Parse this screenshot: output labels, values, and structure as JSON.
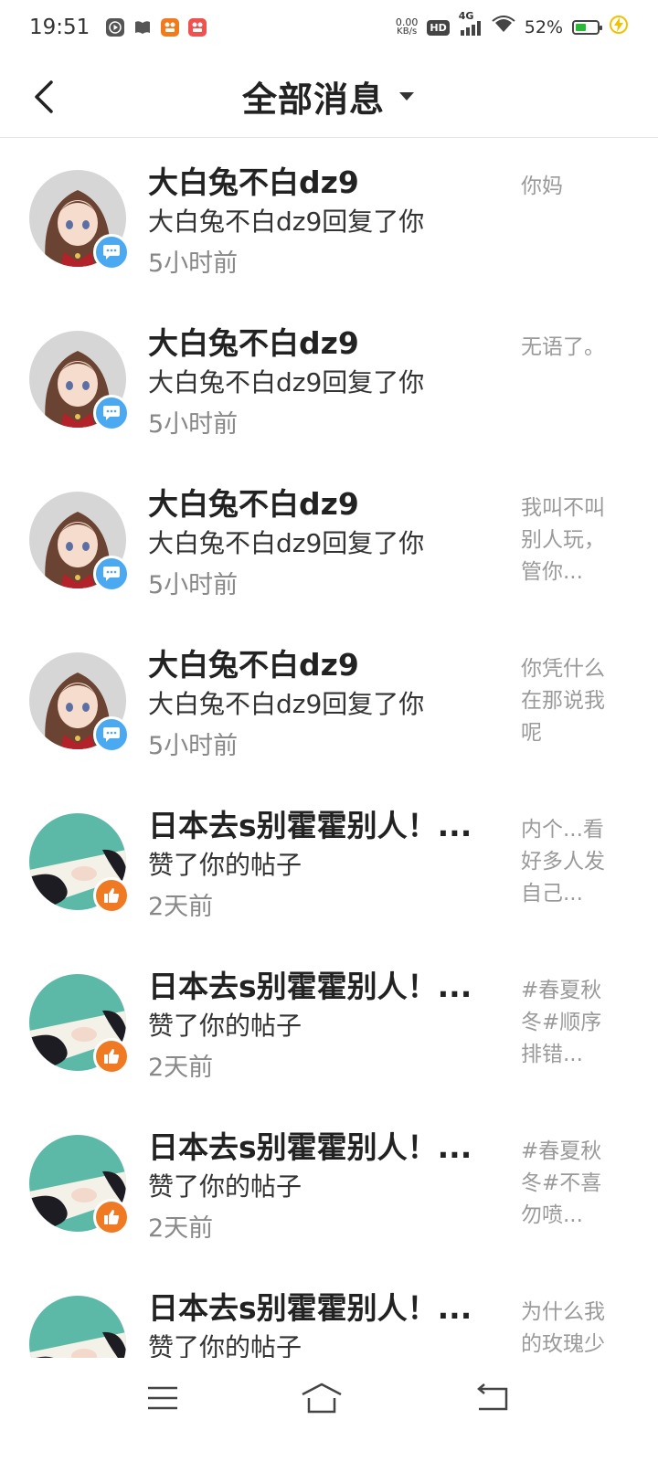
{
  "status_bar": {
    "time": "19:51",
    "net_speed_value": "0.00",
    "net_speed_unit": "KB/s",
    "hd_label": "HD",
    "network_type": "4G",
    "battery_percent": "52%",
    "battery_level": 0.52,
    "icons": [
      "play-icon",
      "book-icon",
      "app-orange-icon",
      "app-red-icon",
      "wifi-icon",
      "signal-icon",
      "battery-icon",
      "charging-icon"
    ]
  },
  "nav": {
    "title": "全部消息"
  },
  "messages": [
    {
      "name": "大白兔不白dz9",
      "action": "大白兔不白dz9回复了你",
      "time": "5小时前",
      "preview": "你妈",
      "avatar": "anime-girl",
      "badge": "comment",
      "badge_color": "#4aa9f0"
    },
    {
      "name": "大白兔不白dz9",
      "action": "大白兔不白dz9回复了你",
      "time": "5小时前",
      "preview": "无语了。",
      "avatar": "anime-girl",
      "badge": "comment",
      "badge_color": "#4aa9f0"
    },
    {
      "name": "大白兔不白dz9",
      "action": "大白兔不白dz9回复了你",
      "time": "5小时前",
      "preview": "我叫不叫别人玩，管你...",
      "avatar": "anime-girl",
      "badge": "comment",
      "badge_color": "#4aa9f0"
    },
    {
      "name": "大白兔不白dz9",
      "action": "大白兔不白dz9回复了你",
      "time": "5小时前",
      "preview": "你凭什么在那说我呢",
      "avatar": "anime-girl",
      "badge": "comment",
      "badge_color": "#4aa9f0"
    },
    {
      "name": "日本去s别霍霍别人！...",
      "action": "赞了你的帖子",
      "time": "2天前",
      "preview": "内个...看好多人发自己...",
      "avatar": "teal-art",
      "badge": "like",
      "badge_color": "#f07a24"
    },
    {
      "name": "日本去s别霍霍别人！...",
      "action": "赞了你的帖子",
      "time": "2天前",
      "preview": "#春夏秋冬#顺序排错...",
      "avatar": "teal-art",
      "badge": "like",
      "badge_color": "#f07a24"
    },
    {
      "name": "日本去s别霍霍别人！...",
      "action": "赞了你的帖子",
      "time": "2天前",
      "preview": "#春夏秋冬#不喜勿喷...",
      "avatar": "teal-art",
      "badge": "like",
      "badge_color": "#f07a24"
    },
    {
      "name": "日本去s别霍霍别人！...",
      "action": "赞了你的帖子",
      "time": "",
      "preview": "为什么我的玫瑰少",
      "avatar": "teal-art",
      "badge": "like",
      "badge_color": "#f07a24"
    }
  ],
  "bottom_nav": {
    "icons": [
      "menu-icon",
      "home-icon",
      "back-icon"
    ]
  }
}
